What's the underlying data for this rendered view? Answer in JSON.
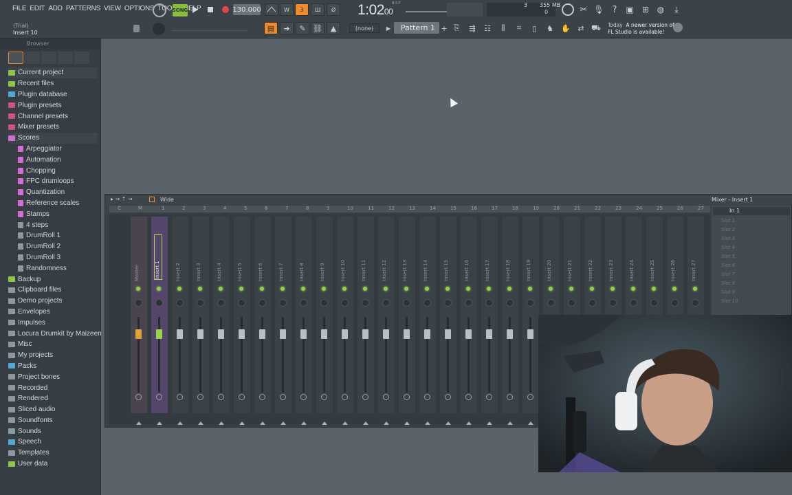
{
  "menu": [
    "FILE",
    "EDIT",
    "ADD",
    "PATTERNS",
    "VIEW",
    "OPTIONS",
    "TOOLS",
    "HELP"
  ],
  "hint": {
    "line1": "(Trial)",
    "line2": "Insert 10"
  },
  "transport": {
    "song_label": "SONG",
    "tempo": "130.000",
    "time": "1:02",
    "time_sub": "00",
    "time_unit": "B:S:T"
  },
  "cpu": {
    "value1": "3",
    "value2": "355 MB",
    "value3": "0"
  },
  "pattern": {
    "none_label": "(none)",
    "name": "Pattern 1"
  },
  "news": {
    "day": "Today",
    "line1": "A newer version of",
    "line2": "FL Studio is available!"
  },
  "browser": {
    "title": "Browser",
    "items": [
      {
        "label": "Current project",
        "icon": "folder-icon",
        "color": "#8fc44a",
        "child": false,
        "selected": true
      },
      {
        "label": "Recent files",
        "icon": "folder-icon",
        "color": "#8fc44a",
        "child": false
      },
      {
        "label": "Plugin database",
        "icon": "plug-icon",
        "color": "#4fa8d6",
        "child": false
      },
      {
        "label": "Plugin presets",
        "icon": "plug-icon",
        "color": "#d04f8a",
        "child": false
      },
      {
        "label": "Channel presets",
        "icon": "plug-icon",
        "color": "#d04f8a",
        "child": false
      },
      {
        "label": "Mixer presets",
        "icon": "plug-icon",
        "color": "#d04f8a",
        "child": false
      },
      {
        "label": "Scores",
        "icon": "note-icon",
        "color": "#d06fd0",
        "child": false,
        "selected": true
      },
      {
        "label": "Arpeggiator",
        "icon": "note-icon",
        "color": "#d06fd0",
        "child": true
      },
      {
        "label": "Automation",
        "icon": "note-icon",
        "color": "#d06fd0",
        "child": true
      },
      {
        "label": "Chopping",
        "icon": "note-icon",
        "color": "#d06fd0",
        "child": true
      },
      {
        "label": "FPC drumloops",
        "icon": "note-icon",
        "color": "#d06fd0",
        "child": true
      },
      {
        "label": "Quantization",
        "icon": "note-icon",
        "color": "#d06fd0",
        "child": true
      },
      {
        "label": "Reference scales",
        "icon": "note-icon",
        "color": "#d06fd0",
        "child": true
      },
      {
        "label": "Stamps",
        "icon": "note-icon",
        "color": "#d06fd0",
        "child": true
      },
      {
        "label": "4 steps",
        "icon": "pattern-icon",
        "color": "#8a9aa0",
        "child": true
      },
      {
        "label": "DrumRoll 1",
        "icon": "pattern-icon",
        "color": "#8a9aa0",
        "child": true
      },
      {
        "label": "DrumRoll 2",
        "icon": "pattern-icon",
        "color": "#8a9aa0",
        "child": true
      },
      {
        "label": "DrumRoll 3",
        "icon": "pattern-icon",
        "color": "#8a9aa0",
        "child": true
      },
      {
        "label": "Randomness",
        "icon": "pattern-icon",
        "color": "#8a9aa0",
        "child": true
      },
      {
        "label": "Backup",
        "icon": "folder-icon",
        "color": "#8fc44a",
        "child": false
      },
      {
        "label": "Clipboard files",
        "icon": "folder-icon",
        "color": "#8a9aa0",
        "child": false
      },
      {
        "label": "Demo projects",
        "icon": "folder-icon",
        "color": "#8a9aa0",
        "child": false
      },
      {
        "label": "Envelopes",
        "icon": "folder-icon",
        "color": "#8a9aa0",
        "child": false
      },
      {
        "label": "Impulses",
        "icon": "folder-icon",
        "color": "#8a9aa0",
        "child": false
      },
      {
        "label": "Locura Drumkit by Maizeeno",
        "icon": "folder-icon",
        "color": "#8a9aa0",
        "child": false
      },
      {
        "label": "Misc",
        "icon": "folder-icon",
        "color": "#8a9aa0",
        "child": false
      },
      {
        "label": "My projects",
        "icon": "folder-icon",
        "color": "#8a9aa0",
        "child": false
      },
      {
        "label": "Packs",
        "icon": "folder-icon",
        "color": "#4fa8d6",
        "child": false
      },
      {
        "label": "Project bones",
        "icon": "folder-icon",
        "color": "#8a9aa0",
        "child": false
      },
      {
        "label": "Recorded",
        "icon": "folder-icon",
        "color": "#8a9aa0",
        "child": false
      },
      {
        "label": "Rendered",
        "icon": "folder-icon",
        "color": "#8a9aa0",
        "child": false
      },
      {
        "label": "Sliced audio",
        "icon": "folder-icon",
        "color": "#8a9aa0",
        "child": false
      },
      {
        "label": "Soundfonts",
        "icon": "folder-icon",
        "color": "#8a9aa0",
        "child": false
      },
      {
        "label": "Sounds",
        "icon": "cloud-icon",
        "color": "#8a9aa0",
        "child": false
      },
      {
        "label": "Speech",
        "icon": "folder-icon",
        "color": "#4fa8d6",
        "child": false
      },
      {
        "label": "Templates",
        "icon": "folder-icon",
        "color": "#8a9aa0",
        "child": false
      },
      {
        "label": "User data",
        "icon": "user-icon",
        "color": "#8fc44a",
        "child": false
      }
    ]
  },
  "mixer": {
    "mode_label": "Wide",
    "title": "Mixer - Insert 1",
    "input_label": "In 1",
    "strips": [
      "Master",
      "Insert 1",
      "Insert 2",
      "Insert 3",
      "Insert 4",
      "Insert 5",
      "Insert 6",
      "Insert 7",
      "Insert 8",
      "Insert 9",
      "Insert 10",
      "Insert 11",
      "Insert 12",
      "Insert 13",
      "Insert 14",
      "Insert 15",
      "Insert 16",
      "Insert 17",
      "Insert 18",
      "Insert 19",
      "Insert 20",
      "Insert 21",
      "Insert 22",
      "Insert 23",
      "Insert 24",
      "Insert 25",
      "Insert 26",
      "Insert 27"
    ],
    "ruler": [
      "C",
      "M",
      "1",
      "2",
      "3",
      "4",
      "5",
      "6",
      "7",
      "8",
      "9",
      "10",
      "11",
      "12",
      "13",
      "14",
      "15",
      "16",
      "17",
      "18",
      "19",
      "20",
      "21",
      "22",
      "23",
      "24",
      "25",
      "26",
      "27"
    ],
    "slots": [
      "Slot 1",
      "Slot 2",
      "Slot 3",
      "Slot 4",
      "Slot 5",
      "Slot 6",
      "Slot 7",
      "Slot 8",
      "Slot 9",
      "Slot 10"
    ]
  },
  "colors": {
    "accent": "#ef8b2b",
    "song": "#8bbd3c",
    "selected": "#54466a",
    "led": "#8fd04a"
  }
}
